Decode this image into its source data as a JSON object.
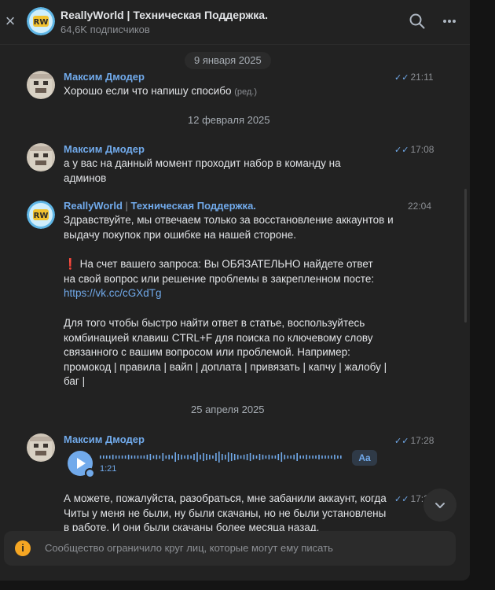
{
  "header": {
    "title": "ReallyWorld | Техническая Поддержка.",
    "subscribers": "64,6K подписчиков",
    "close_icon": "close-icon",
    "search_icon": "search-icon",
    "more_icon": "more-icon"
  },
  "dates": [
    "9 января 2025",
    "12 февраля 2025",
    "25 апреля 2025"
  ],
  "messages": [
    {
      "author": "Максим Дмодер",
      "time": "21:11",
      "text": "Хорошо если что напишу спосибо",
      "edited": "(ред.)"
    },
    {
      "author": "Максим Дмодер",
      "time": "17:08",
      "text": "а у вас на данный момент проходит набор в команду на админов"
    },
    {
      "author_name": "ReallyWorld",
      "author_sep": "|",
      "author_rest": "Техническая Поддержка.",
      "time": "22:04",
      "p1": "Здравствуйте, мы отвечаем только за восстановление аккаунтов и выдачу покупок при ошибке на нашей стороне.",
      "p2_icon": "❗",
      "p2": "На счет вашего запроса: Вы ОБЯЗАТЕЛЬНО найдете ответ на свой вопрос или решение проблемы в закрепленном посте:",
      "p2_link": "https://vk.cc/cGXdTg",
      "p3": "Для того чтобы быстро найти ответ в статье, воспользуйтесь комбинацией клавиш CTRL+F для поиска по ключевому слову связанного с вашим вопросом или проблемой. Например: промокод | правила | вайп | доплата | привязать | капчу | жалобу | баг |"
    },
    {
      "author": "Максим Дмодер",
      "time": "17:28",
      "voice_duration": "1:21",
      "transcribe_label": "Aa"
    },
    {
      "time": "17:29",
      "text": "А можете, пожалуйста, разобраться, мне забанили аккаунт, когда Читы у меня не были, ну были скачаны, но не были установлены в работе. И они были скачаны более месяца назад."
    }
  ],
  "notice": {
    "icon": "info-icon",
    "text": "Сообщество ограничило круг лиц, которые могут ему писать"
  },
  "colors": {
    "accent": "#71aaeb",
    "background": "#222222",
    "warning": "#f5a623"
  }
}
